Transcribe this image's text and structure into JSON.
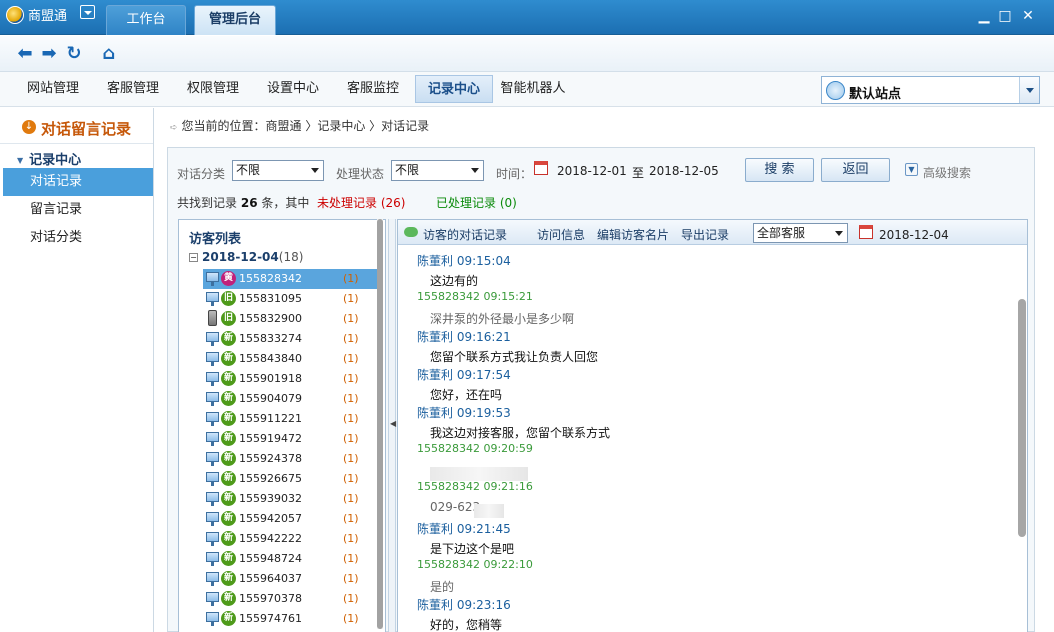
{
  "app": {
    "name": "商盟通",
    "tabs": [
      {
        "label": "工作台"
      },
      {
        "label": "管理后台"
      }
    ]
  },
  "menu": {
    "items": [
      "网站管理",
      "客服管理",
      "权限管理",
      "设置中心",
      "客服监控",
      "记录中心",
      "智能机器人"
    ],
    "active": "记录中心",
    "site": "默认站点"
  },
  "sidebar": {
    "header": "对话留言记录",
    "group": "记录中心",
    "items": [
      "对话记录",
      "留言记录",
      "对话分类"
    ]
  },
  "breadcrumb": "您当前的位置：商盟通 〉记录中心 〉对话记录",
  "filters": {
    "category_label": "对话分类",
    "category_value": "不限",
    "status_label": "处理状态",
    "status_value": "不限",
    "time_label": "时间：",
    "date_from": "2018-12-01",
    "date_to_sep": "至",
    "date_to": "2018-12-05",
    "search_btn": "搜 索",
    "back_btn": "返回",
    "advanced": "高级搜索"
  },
  "summary": {
    "prefix": "共找到记录",
    "total": "26",
    "mid": "条，其中",
    "unprocessed": "未处理记录 (26)",
    "processed": "已处理记录 (0)"
  },
  "visitors": {
    "title": "访客列表",
    "date": "2018-12-04",
    "date_count": "(18)",
    "rows": [
      {
        "id": "155828342",
        "badge": "黄",
        "count": "(1)"
      },
      {
        "id": "155831095",
        "badge": "旧",
        "count": "(1)"
      },
      {
        "id": "155832900",
        "badge": "旧",
        "count": "(1)"
      },
      {
        "id": "155833274",
        "badge": "新",
        "count": "(1)"
      },
      {
        "id": "155843840",
        "badge": "新",
        "count": "(1)"
      },
      {
        "id": "155901918",
        "badge": "新",
        "count": "(1)"
      },
      {
        "id": "155904079",
        "badge": "新",
        "count": "(1)"
      },
      {
        "id": "155911221",
        "badge": "新",
        "count": "(1)"
      },
      {
        "id": "155919472",
        "badge": "新",
        "count": "(1)"
      },
      {
        "id": "155924378",
        "badge": "新",
        "count": "(1)"
      },
      {
        "id": "155926675",
        "badge": "新",
        "count": "(1)"
      },
      {
        "id": "155939032",
        "badge": "新",
        "count": "(1)"
      },
      {
        "id": "155942057",
        "badge": "新",
        "count": "(1)"
      },
      {
        "id": "155942222",
        "badge": "新",
        "count": "(1)"
      },
      {
        "id": "155948724",
        "badge": "新",
        "count": "(1)"
      },
      {
        "id": "155964037",
        "badge": "新",
        "count": "(1)"
      },
      {
        "id": "155970378",
        "badge": "新",
        "count": "(1)"
      },
      {
        "id": "155974761",
        "badge": "新",
        "count": "(1)"
      }
    ]
  },
  "conversation": {
    "tabs": [
      "访客的对话记录",
      "访问信息",
      "编辑访客名片",
      "导出记录"
    ],
    "agent_filter": "全部客服",
    "date": "2018-12-04",
    "messages": [
      {
        "head": "陈董利 09:15:04",
        "body": "这边有的",
        "role": "agent"
      },
      {
        "head": "155828342 09:15:21",
        "body": "深井泵的外径最小是多少啊",
        "role": "visitor"
      },
      {
        "head": "陈董利 09:16:21",
        "body": "您留个联系方式我让负责人回您",
        "role": "agent"
      },
      {
        "head": "陈董利 09:17:54",
        "body": "您好，还在吗",
        "role": "agent"
      },
      {
        "head": "陈董利 09:19:53",
        "body": "我这边对接客服，您留个联系方式",
        "role": "agent"
      },
      {
        "head": "155828342 09:20:59",
        "body": "",
        "role": "visitor"
      },
      {
        "head": "155828342 09:21:16",
        "body": "029-623",
        "role": "visitor"
      },
      {
        "head": "陈董利 09:21:45",
        "body": "是下边这个是吧",
        "role": "agent"
      },
      {
        "head": "155828342 09:22:10",
        "body": "是的",
        "role": "visitor"
      },
      {
        "head": "陈董利 09:23:16",
        "body": "好的，您稍等",
        "role": "agent"
      }
    ]
  },
  "colors": {
    "titlebar": "#1c6fb2",
    "accent": "#4a9fdc",
    "unprocessed": "#cc0000",
    "processed": "#0a8a0a"
  }
}
